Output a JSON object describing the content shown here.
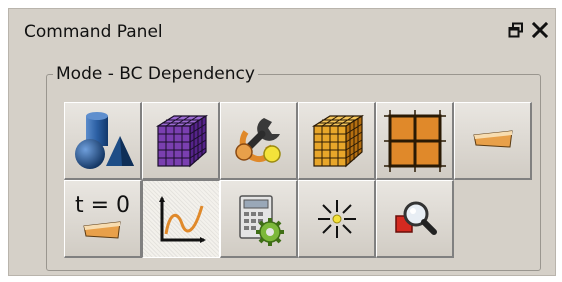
{
  "panel": {
    "title": "Command Panel",
    "restore_icon": "restore-window-icon",
    "close_icon": "close-icon"
  },
  "group": {
    "title": "Mode - BC Dependency"
  },
  "toolbar": {
    "row1": [
      {
        "icon": "geometry-shapes-icon"
      },
      {
        "icon": "mesh-cube-icon"
      },
      {
        "icon": "physics-wrench-icon"
      },
      {
        "icon": "mesh-cube-orange-icon"
      },
      {
        "icon": "grid-plane-icon"
      },
      {
        "icon": "boundary-strip-icon"
      }
    ],
    "row2": [
      {
        "icon": "initial-condition-icon",
        "label": "t = 0"
      },
      {
        "icon": "curve-graph-icon",
        "active": true
      },
      {
        "icon": "calculator-gear-icon"
      },
      {
        "icon": "light-burst-icon"
      },
      {
        "icon": "magnifier-icon"
      }
    ]
  },
  "colors": {
    "panel_bg": "#d5d0c8",
    "accent_orange": "#e0892a",
    "mesh_purple": "#7a3fb0",
    "mesh_gold": "#e8a62a",
    "shape_blue": "#1e4d86"
  }
}
